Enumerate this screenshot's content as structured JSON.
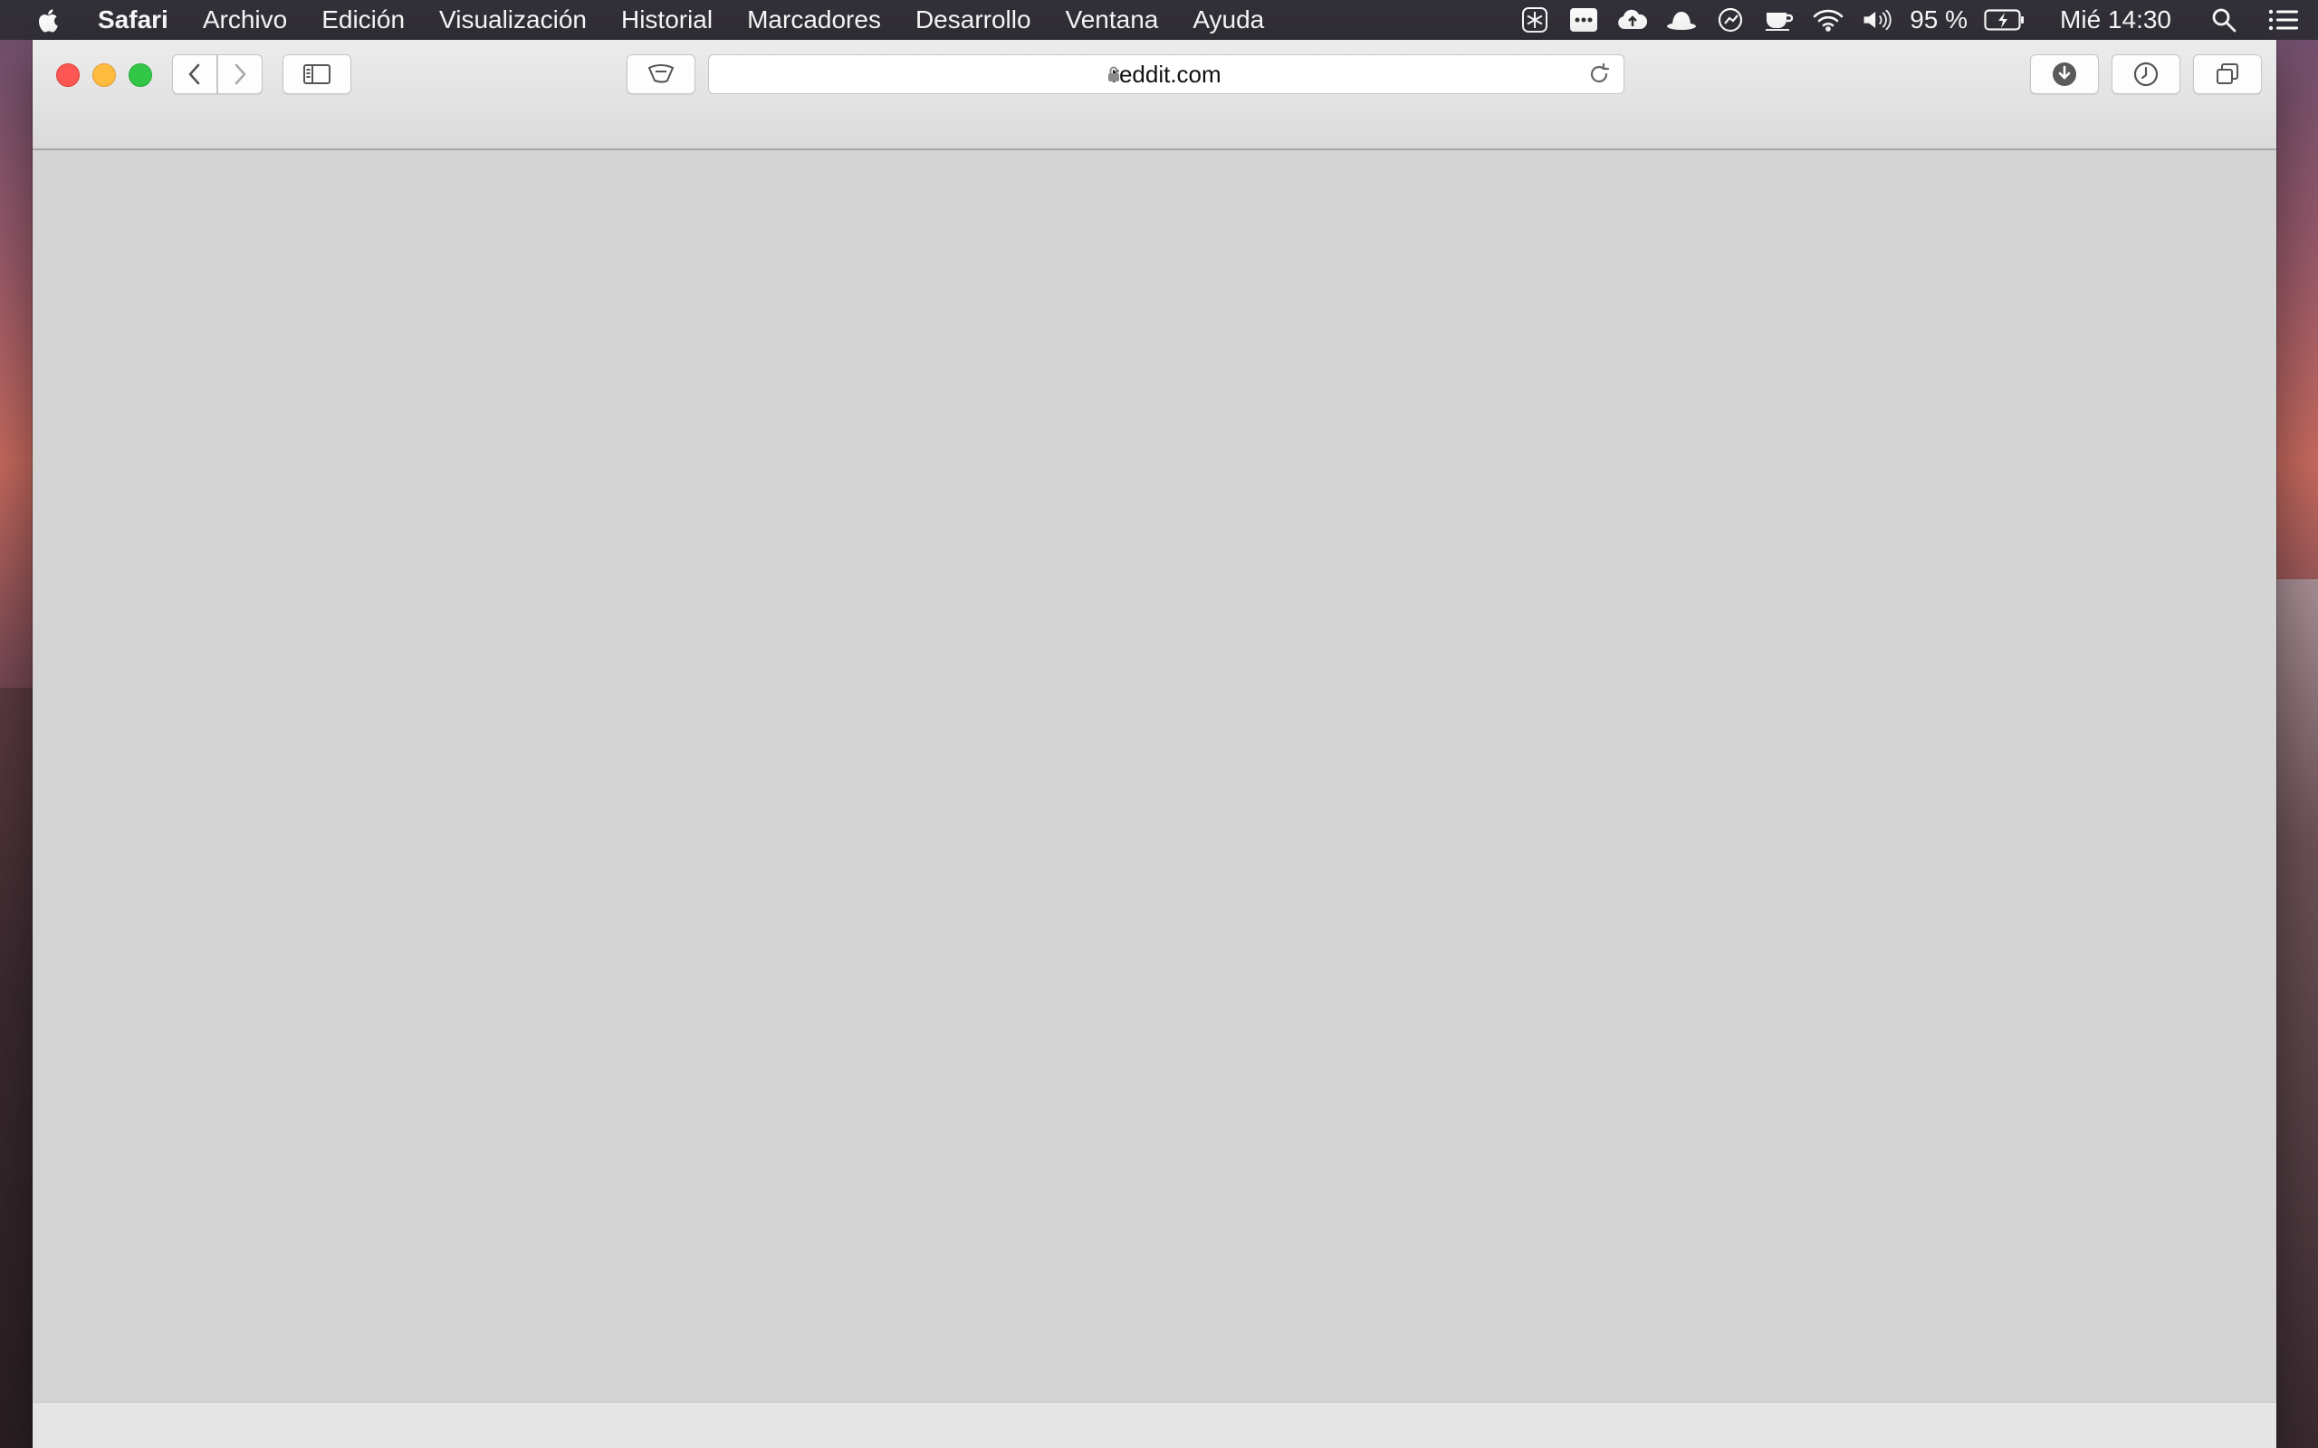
{
  "menubar": {
    "app_name": "Safari",
    "items": [
      "Archivo",
      "Edición",
      "Visualización",
      "Historial",
      "Marcadores",
      "Desarrollo",
      "Ventana",
      "Ayuda"
    ],
    "battery_percent": "95 %",
    "clock": "Mié 14:30",
    "status_icons": [
      "snowflake-icon",
      "dots-icon",
      "cloud-upload-icon",
      "bowler-hat-icon",
      "gauge-icon",
      "coffee-cup-icon",
      "wifi-icon",
      "volume-icon",
      "battery-charging-icon",
      "search-icon",
      "list-icon"
    ]
  },
  "browser": {
    "url": "reddit.com",
    "colors": {
      "close": "#fc5753",
      "minimize": "#fdbc40",
      "maximize": "#33c748"
    }
  }
}
